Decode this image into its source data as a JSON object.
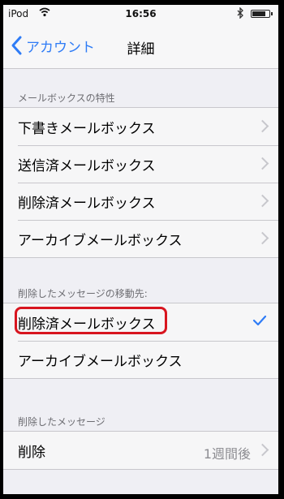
{
  "status_bar": {
    "carrier": "iPod",
    "time": "16:56",
    "battery_level": 0.8
  },
  "nav": {
    "back_label": "アカウント",
    "title": "詳細"
  },
  "mailbox_behaviors": {
    "header": "メールボックスの特性",
    "items": [
      {
        "label": "下書きメールボックス"
      },
      {
        "label": "送信済メールボックス"
      },
      {
        "label": "削除済メールボックス"
      },
      {
        "label": "アーカイブメールボックス"
      }
    ]
  },
  "move_discarded": {
    "header": "削除したメッセージの移動先:",
    "items": [
      {
        "label": "削除済メールボックス",
        "selected": true
      },
      {
        "label": "アーカイブメールボックス",
        "selected": false
      }
    ]
  },
  "deleted_messages": {
    "header": "削除したメッセージ",
    "items": [
      {
        "label": "削除",
        "value": "1週間後"
      }
    ]
  },
  "colors": {
    "accent": "#2f7cf6",
    "annotation": "#d8151f"
  }
}
